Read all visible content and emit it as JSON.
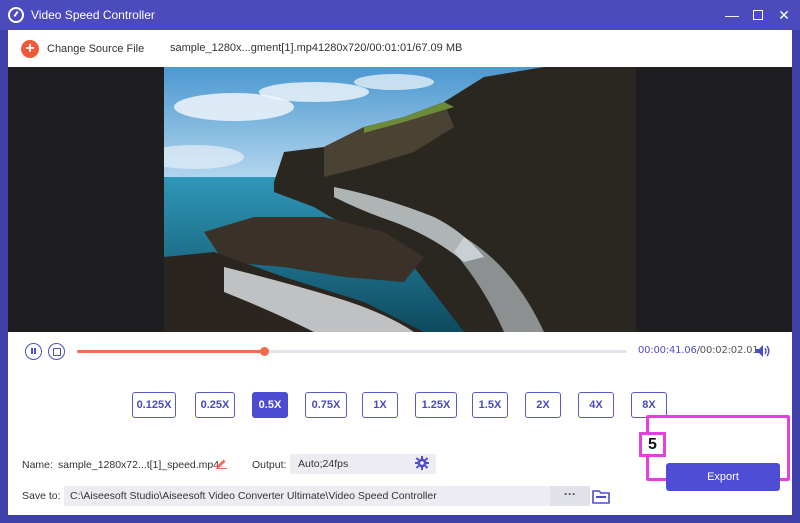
{
  "window": {
    "title": "Video Speed Controller",
    "minimize_glyph": "—",
    "close_glyph": "✕"
  },
  "source_bar": {
    "change_source_label": "Change Source File",
    "file_name": "sample_1280x...gment[1].mp4",
    "file_info": "1280x720/00:01:01/67.09 MB"
  },
  "player": {
    "current_time": "00:00:41.06",
    "separator": "/",
    "total_time": "00:02:02.01",
    "progress_fraction": 0.34
  },
  "speed_options": [
    {
      "label": "0.125X",
      "active": false
    },
    {
      "label": "0.25X",
      "active": false
    },
    {
      "label": "0.5X",
      "active": true
    },
    {
      "label": "0.75X",
      "active": false
    },
    {
      "label": "1X",
      "active": false
    },
    {
      "label": "1.25X",
      "active": false
    },
    {
      "label": "1.5X",
      "active": false
    },
    {
      "label": "2X",
      "active": false
    },
    {
      "label": "4X",
      "active": false
    },
    {
      "label": "8X",
      "active": false
    }
  ],
  "settings": {
    "name_label": "Name:",
    "name_value": "sample_1280x72...t[1]_speed.mp4",
    "output_label": "Output:",
    "output_value": "Auto;24fps",
    "save_label": "Save to:",
    "save_path": "C:\\Aiseesoft Studio\\Aiseesoft Video Converter Ultimate\\Video Speed Controller",
    "more_label": "···"
  },
  "export": {
    "label": "Export",
    "step_number": "5"
  },
  "colors": {
    "accent": "#4d4dd6",
    "progress": "#f26b4a",
    "highlight": "#e53ee3"
  }
}
